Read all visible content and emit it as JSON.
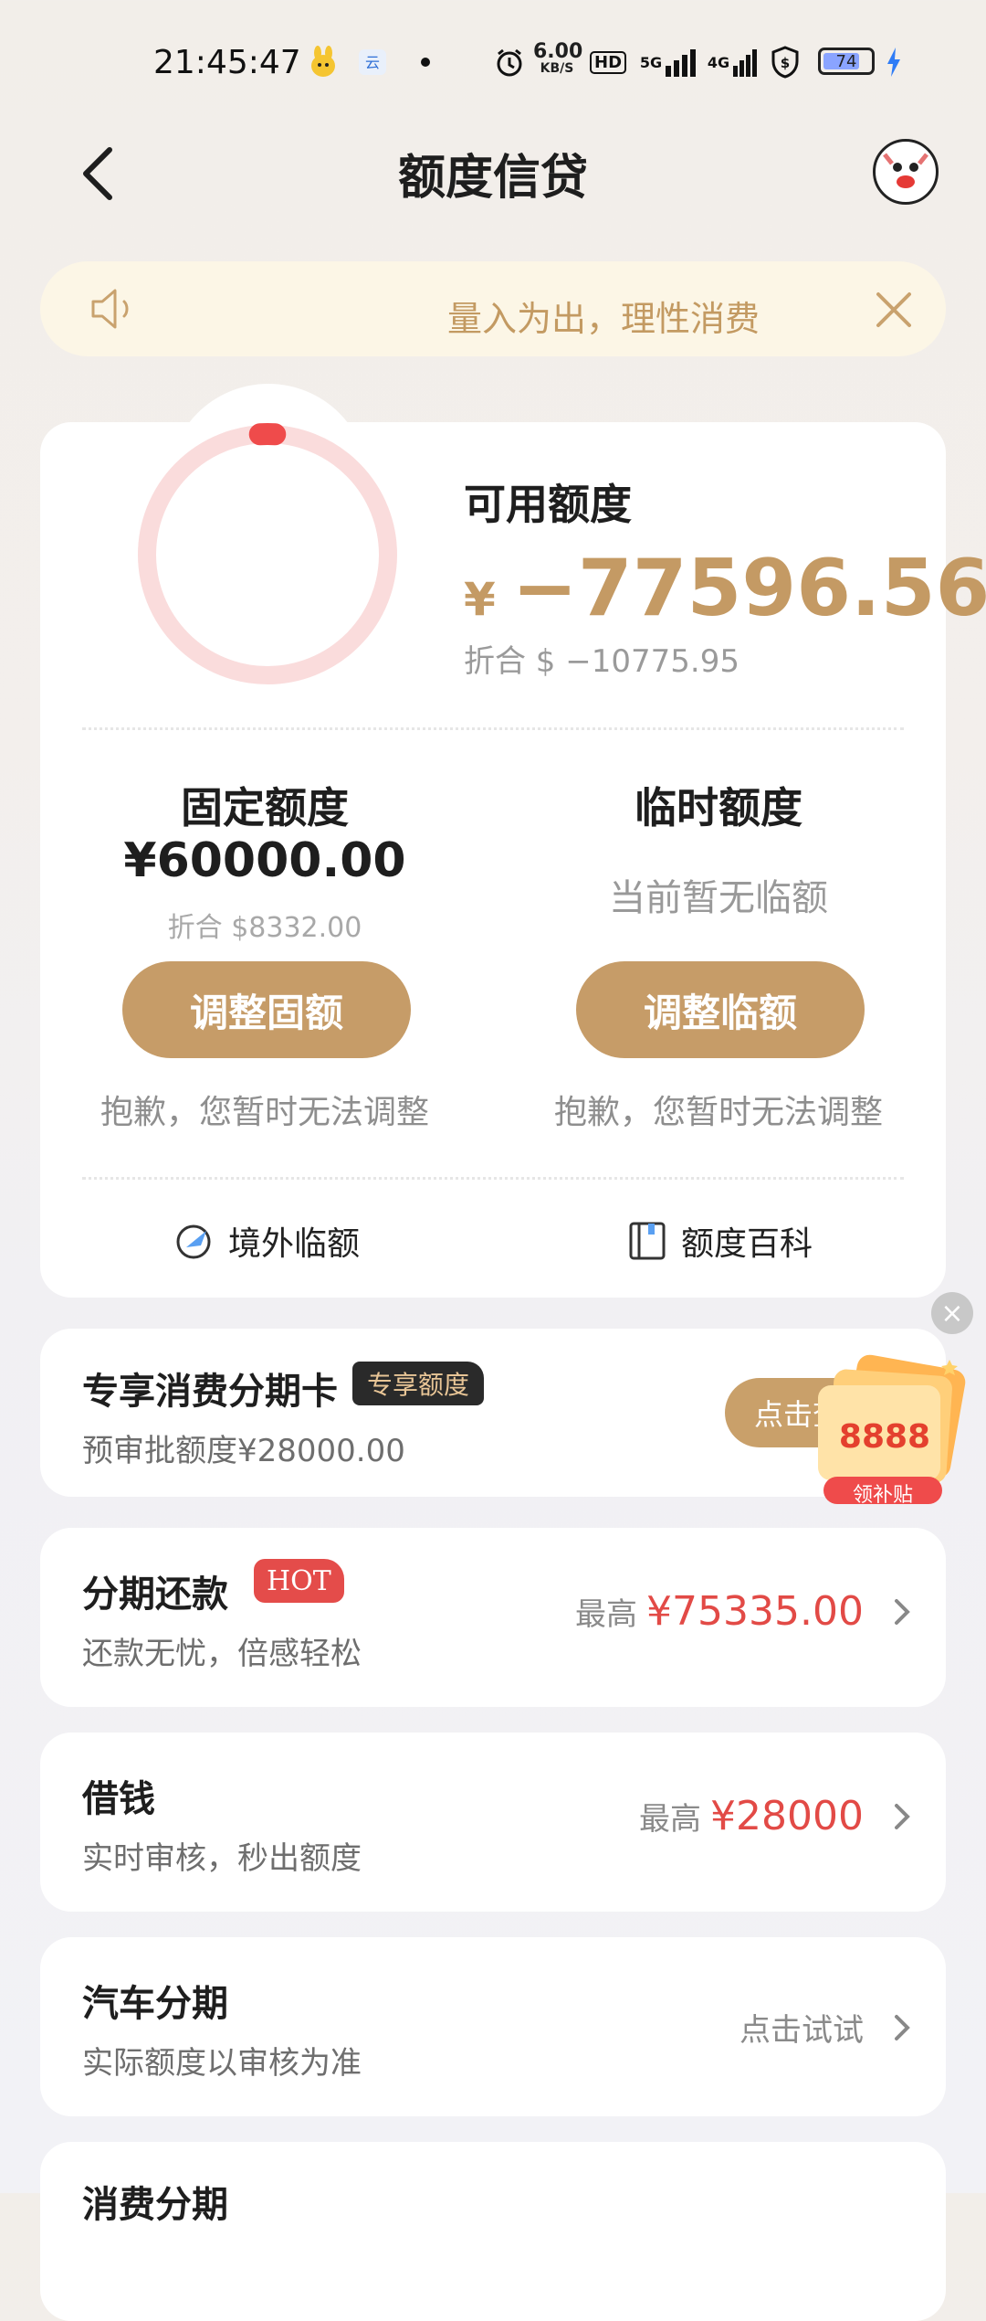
{
  "status_bar": {
    "time": "21:45:47",
    "net_speed": "6.00",
    "net_unit": "KB/S",
    "hd": "HD",
    "sig1": "5G",
    "sig2": "4G",
    "battery": "74"
  },
  "nav": {
    "title": "额度信贷"
  },
  "notice": {
    "text": "量入为出，理性消费"
  },
  "credit": {
    "available_label": "可用额度",
    "currency": "¥",
    "available_amount": "−77596.56",
    "usd_equiv": "折合 $ −10775.95",
    "ring_used_fraction": 0.02
  },
  "fixed": {
    "title": "固定额度",
    "amount": "¥60000.00",
    "usd": "折合 $8332.00",
    "button": "调整固额",
    "note": "抱歉，您暂时无法调整"
  },
  "temp": {
    "title": "临时额度",
    "status": "当前暂无临额",
    "button": "调整临额",
    "note": "抱歉，您暂时无法调整"
  },
  "links": {
    "overseas": "境外临额",
    "wiki": "额度百科"
  },
  "exclusive": {
    "title": "专享消费分期卡",
    "badge": "专享额度",
    "subtitle": "预审批额度¥28000.00",
    "button": "点击查",
    "promo_amount": "8888",
    "promo_label": "领补贴"
  },
  "rows": [
    {
      "title": "分期还款",
      "badge": "HOT",
      "subtitle": "还款无忧，倍感轻松",
      "prefix": "最高",
      "value": "¥75335.00"
    },
    {
      "title": "借钱",
      "subtitle": "实时审核，秒出额度",
      "prefix": "最高",
      "value": "¥28000"
    },
    {
      "title": "汽车分期",
      "subtitle": "实际额度以审核为准",
      "action": "点击试试"
    },
    {
      "title": "消费分期"
    }
  ],
  "colors": {
    "gold": "#c69c68",
    "red": "#e24a46",
    "ring_track": "#fadcdc",
    "ring_indicator": "#ef4b4b"
  }
}
